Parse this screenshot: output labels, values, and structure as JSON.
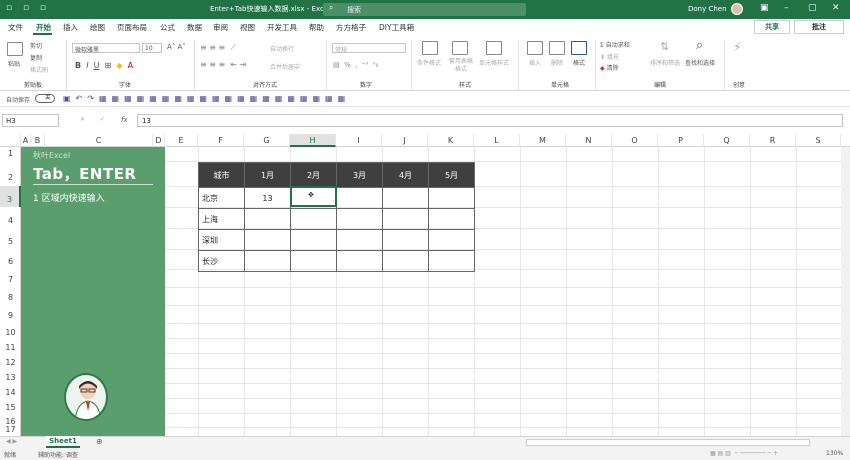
{
  "title_bar": {
    "doc_title": "Enter+Tab快速输入数据.xlsx - Excel",
    "search_placeholder": "搜索",
    "user_name": "Dony Chen"
  },
  "tabs": [
    "文件",
    "开始",
    "插入",
    "绘图",
    "页面布局",
    "公式",
    "数据",
    "审阅",
    "视图",
    "开发工具",
    "帮助",
    "方方格子",
    "DIY工具箱"
  ],
  "tab_active": "开始",
  "actions": {
    "share": "共享",
    "comment": "批注"
  },
  "ribbon": {
    "clipboard": {
      "paste": "粘贴",
      "cut": "剪切",
      "copy": "复制",
      "format_painter": "格式刷",
      "group": "剪贴板"
    },
    "font": {
      "name": "微软雅黑",
      "size": "10",
      "group": "字体"
    },
    "alignment": {
      "wrap": "自动换行",
      "merge": "合并后居中",
      "group": "对齐方式"
    },
    "number": {
      "format": "常规",
      "group": "数字"
    },
    "styles": {
      "conditional": "条件格式",
      "table": "套用表格格式",
      "cell_styles": "单元格样式",
      "group": "样式"
    },
    "cells": {
      "insert": "插入",
      "delete": "删除",
      "format": "格式",
      "group": "单元格"
    },
    "editing": {
      "autosum": "自动求和",
      "fill": "填充",
      "clear": "清除",
      "sort": "排序和筛选",
      "find": "查找和选择",
      "group": "编辑"
    },
    "ideas": {
      "label": "创意"
    }
  },
  "quick_access": {
    "autosave": "自动保存",
    "toggle": "关"
  },
  "formula_bar": {
    "name_box": "H3",
    "fx": "fx",
    "content": "13"
  },
  "columns": [
    "A",
    "B",
    "C",
    "D",
    "E",
    "F",
    "G",
    "H",
    "I",
    "J",
    "K",
    "L",
    "M",
    "N",
    "O",
    "P",
    "Q",
    "R",
    "S"
  ],
  "selected_column": "H",
  "rows": [
    "1",
    "2",
    "3",
    "4",
    "5",
    "6",
    "7",
    "8",
    "9",
    "10",
    "11",
    "12",
    "13",
    "14",
    "15",
    "16",
    "17"
  ],
  "selected_row": "3",
  "panel": {
    "logo": "秋叶Excel",
    "heading": "Tab，ENTER",
    "subtitle": "1  区域内快速输入"
  },
  "table": {
    "headers": [
      "城市",
      "1月",
      "2月",
      "3月",
      "4月",
      "5月"
    ],
    "rows": [
      [
        "北京",
        "13",
        "",
        "",
        "",
        ""
      ],
      [
        "上海",
        "",
        "",
        "",
        "",
        ""
      ],
      [
        "深圳",
        "",
        "",
        "",
        "",
        ""
      ],
      [
        "长沙",
        "",
        "",
        "",
        "",
        ""
      ]
    ]
  },
  "sheets": [
    "Sheet1"
  ],
  "status": {
    "mode": "就绪",
    "accessibility": "辅助功能: 调查",
    "zoom": "130%"
  }
}
